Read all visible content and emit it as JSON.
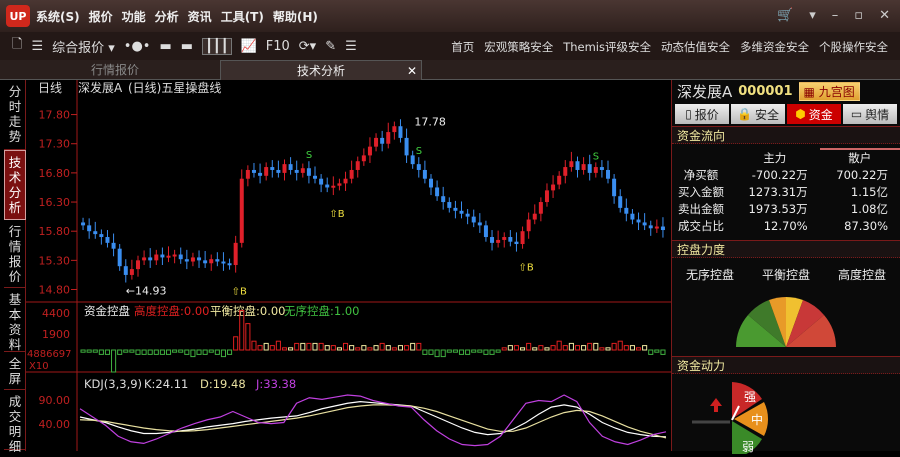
{
  "app": {
    "logo": "UP",
    "menu": [
      "系统(S)",
      "报价",
      "功能",
      "分析",
      "资讯",
      "工具(T)",
      "帮助(H)"
    ]
  },
  "toolbar": {
    "quote_dropdown": "综合报价 ▾",
    "f10": "F10",
    "links": [
      "首页",
      "宏观策略安全",
      "Themis评级安全",
      "动态估值安全",
      "多维资金安全",
      "个股操作安全"
    ]
  },
  "tabs": [
    {
      "label": "行情报价"
    },
    {
      "label": "技术分析"
    }
  ],
  "vtabs": [
    "分时走势",
    "技术分析",
    "行情报价",
    "基本资料",
    "全屏",
    "成交明细"
  ],
  "chart_header": {
    "period": "日线",
    "name": "深发展A",
    "indicator": "(日线)五星操盘线"
  },
  "chart_data": [
    {
      "type": "candlestick",
      "name": "price",
      "yticks": [
        17.8,
        17.3,
        16.8,
        16.3,
        15.8,
        15.3,
        14.8
      ],
      "ylim": [
        14.62,
        18.05
      ],
      "closes": [
        15.9,
        15.8,
        15.75,
        15.7,
        15.6,
        15.5,
        15.2,
        15.05,
        15.15,
        15.3,
        15.35,
        15.3,
        15.4,
        15.35,
        15.38,
        15.4,
        15.32,
        15.28,
        15.35,
        15.3,
        15.25,
        15.32,
        15.28,
        15.25,
        15.22,
        15.6,
        16.7,
        16.85,
        16.8,
        16.75,
        16.9,
        16.85,
        16.8,
        16.95,
        16.85,
        16.8,
        16.88,
        16.75,
        16.7,
        16.6,
        16.55,
        16.58,
        16.62,
        16.7,
        16.85,
        17.0,
        17.1,
        17.25,
        17.4,
        17.3,
        17.5,
        17.6,
        17.4,
        17.1,
        16.95,
        16.85,
        16.7,
        16.55,
        16.4,
        16.3,
        16.2,
        16.15,
        16.1,
        16.05,
        15.95,
        15.9,
        15.7,
        15.6,
        15.65,
        15.7,
        15.62,
        15.58,
        15.8,
        16.0,
        16.1,
        16.3,
        16.5,
        16.6,
        16.75,
        16.9,
        17.0,
        16.85,
        16.95,
        16.8,
        16.9,
        16.85,
        16.7,
        16.4,
        16.2,
        16.1,
        16.0,
        15.95,
        15.9,
        15.85,
        15.88,
        15.82
      ],
      "low_label": "←14.93",
      "low_index": 7,
      "high_label": "17.78",
      "high_index": 51,
      "buy_marks": [
        25,
        41,
        72
      ],
      "sell_marks": [
        37,
        55,
        84
      ]
    },
    {
      "type": "bar",
      "name": "资金控盘",
      "title": "资金控盘",
      "labels": [
        "高度控盘:0.00",
        "平衡控盘:0.00",
        "无序控盘:1.00"
      ],
      "yticks": [
        "4400",
        "1900",
        "4886697"
      ],
      "unit": "X10",
      "values": [
        -1,
        -1,
        -1,
        -2,
        -2,
        -10,
        -2,
        -1,
        -1,
        -2,
        -2,
        -2,
        -2,
        -2,
        -2,
        -1,
        -1,
        -2,
        -3,
        -2,
        -2,
        -1,
        -2,
        -3,
        -2,
        6,
        18,
        12,
        4,
        2,
        3,
        2,
        4,
        1,
        1,
        3,
        3,
        3,
        3,
        3,
        2,
        2,
        1,
        3,
        2,
        1,
        2,
        1,
        2,
        3,
        2,
        1,
        2,
        2,
        3,
        3,
        -2,
        -2,
        -3,
        -3,
        -1,
        -1,
        -2,
        -2,
        -1,
        -1,
        -2,
        -2,
        -1,
        1,
        2,
        2,
        1,
        3,
        1,
        2,
        1,
        2,
        4,
        2,
        3,
        2,
        2,
        3,
        3,
        1,
        1,
        3,
        4,
        2,
        2,
        1,
        2,
        -2,
        -1,
        -2
      ]
    },
    {
      "type": "line",
      "name": "KDJ",
      "title": "KDJ(3,3,9)",
      "labels": [
        "K:24.11",
        "D:19.48",
        "J:33.38"
      ],
      "yticks": [
        "90.00",
        "40.00"
      ],
      "ylim": [
        0,
        110
      ],
      "series": [
        {
          "name": "K",
          "values": [
            60,
            55,
            50,
            42,
            35,
            30,
            30,
            32,
            35,
            38,
            42,
            45,
            48,
            52,
            55,
            58,
            60,
            62,
            68,
            75,
            80,
            85,
            88,
            86,
            84,
            82,
            80,
            70,
            60,
            50,
            40,
            32,
            28,
            30,
            38,
            50,
            65,
            78,
            82,
            78,
            65,
            50,
            40,
            32,
            28,
            25,
            24
          ]
        },
        {
          "name": "D",
          "values": [
            55,
            54,
            52,
            48,
            44,
            40,
            37,
            35,
            34,
            35,
            37,
            40,
            43,
            46,
            49,
            52,
            55,
            58,
            62,
            67,
            72,
            77,
            80,
            82,
            82,
            81,
            80,
            76,
            70,
            62,
            54,
            46,
            38,
            34,
            34,
            40,
            50,
            60,
            68,
            72,
            70,
            62,
            52,
            42,
            34,
            28,
            22
          ]
        },
        {
          "name": "J",
          "values": [
            75,
            60,
            45,
            25,
            15,
            12,
            20,
            30,
            40,
            48,
            55,
            60,
            70,
            60,
            50,
            48,
            50,
            85,
            95,
            92,
            96,
            100,
            98,
            90,
            85,
            80,
            78,
            55,
            35,
            20,
            10,
            8,
            10,
            25,
            55,
            85,
            90,
            88,
            100,
            88,
            50,
            25,
            15,
            10,
            18,
            28,
            33
          ]
        }
      ]
    }
  ],
  "right": {
    "name": "深发展A",
    "code": "000001",
    "grid_btn": "九宫图",
    "tabs": [
      "报价",
      "安全",
      "资金",
      "舆情"
    ],
    "flow": {
      "title": "资金流向",
      "cols": [
        "主力",
        "散户"
      ],
      "rows": [
        [
          "净买额",
          "-700.22万",
          "700.22万"
        ],
        [
          "买入金额",
          "1273.31万",
          "1.15亿"
        ],
        [
          "卖出金额",
          "1973.53万",
          "1.08亿"
        ],
        [
          "成交占比",
          "12.70%",
          "87.30%"
        ]
      ]
    },
    "control": {
      "title": "控盘力度",
      "labels": [
        "无序控盘",
        "平衡控盘",
        "高度控盘"
      ]
    },
    "power": {
      "title": "资金动力",
      "levels": [
        "强",
        "中",
        "弱"
      ]
    }
  },
  "colors": {
    "up": "#e0202a",
    "down": "#3a8ef0",
    "axis": "#c02020"
  }
}
